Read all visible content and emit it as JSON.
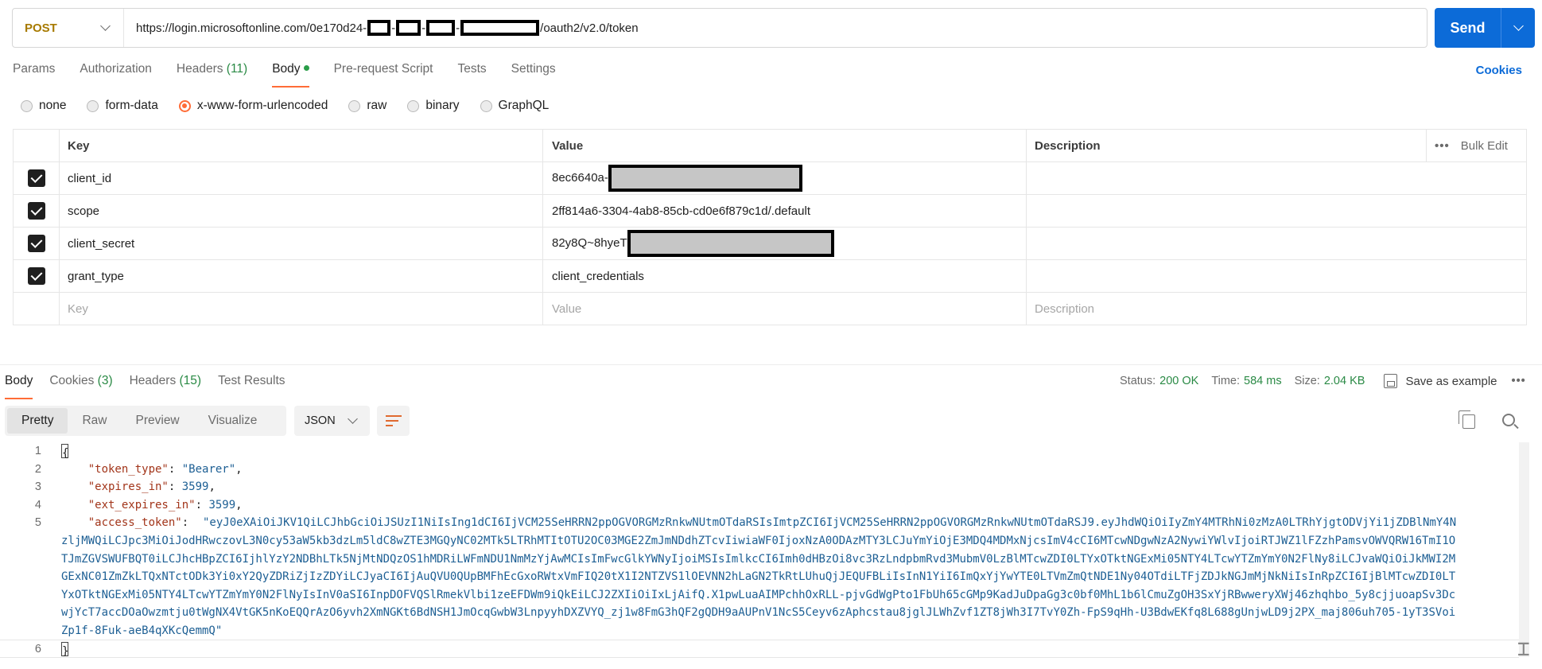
{
  "request": {
    "method": "POST",
    "url_prefix": "https://login.microsoftonline.com/0e170d24-",
    "url_suffix": "/oauth2/v2.0/token",
    "send_label": "Send"
  },
  "tabs": [
    {
      "label": "Params",
      "count": ""
    },
    {
      "label": "Authorization",
      "count": ""
    },
    {
      "label": "Headers",
      "count": "(11)"
    },
    {
      "label": "Body",
      "count": ""
    },
    {
      "label": "Pre-request Script",
      "count": ""
    },
    {
      "label": "Tests",
      "count": ""
    },
    {
      "label": "Settings",
      "count": ""
    }
  ],
  "cookies_link": "Cookies",
  "body_types": [
    "none",
    "form-data",
    "x-www-form-urlencoded",
    "raw",
    "binary",
    "GraphQL"
  ],
  "selected_body_type": "x-www-form-urlencoded",
  "params_table": {
    "headers": {
      "key": "Key",
      "value": "Value",
      "description": "Description",
      "bulk_edit": "Bulk Edit"
    },
    "rows": [
      {
        "checked": true,
        "key": "client_id",
        "value": "8ec6640a-",
        "redacted": true
      },
      {
        "checked": true,
        "key": "scope",
        "value": "2ff814a6-3304-4ab8-85cb-cd0e6f879c1d/.default",
        "redacted": false
      },
      {
        "checked": true,
        "key": "client_secret",
        "value": "82y8Q~8hyeT",
        "redacted": true
      },
      {
        "checked": true,
        "key": "grant_type",
        "value": "client_credentials",
        "redacted": false
      }
    ],
    "placeholder": {
      "key": "Key",
      "value": "Value",
      "description": "Description"
    }
  },
  "response": {
    "tabs": [
      {
        "label": "Body",
        "count": ""
      },
      {
        "label": "Cookies",
        "count": "(3)"
      },
      {
        "label": "Headers",
        "count": "(15)"
      },
      {
        "label": "Test Results",
        "count": ""
      }
    ],
    "status_label": "Status:",
    "status_value": "200 OK",
    "time_label": "Time:",
    "time_value": "584 ms",
    "size_label": "Size:",
    "size_value": "2.04 KB",
    "save_label": "Save as example",
    "views": [
      "Pretty",
      "Raw",
      "Preview",
      "Visualize"
    ],
    "format": "JSON",
    "code": {
      "line_numbers": [
        "1",
        "2",
        "3",
        "4",
        "5",
        "6"
      ],
      "open_brace": "{",
      "close_brace": "}",
      "token_type_key": "\"token_type\"",
      "token_type_val": "\"Bearer\"",
      "expires_in_key": "\"expires_in\"",
      "expires_in_val": "3599",
      "ext_expires_in_key": "\"ext_expires_in\"",
      "ext_expires_in_val": "3599",
      "access_token_key": "\"access_token\"",
      "access_token_val": "\"eyJ0eXAiOiJKV1QiLCJhbGciOiJSUzI1NiIsIng1dCI6IjVCM25SeHRRN2ppOGVORGMzRnkwNUtmOTdaRSIsImtpZCI6IjVCM25SeHRRN2ppOGVORGMzRnkwNUtmOTdaRSJ9.eyJhdWQiOiIyZmY4MTRhNi0zMzA0LTRhYjgtODVjYi1jZDBlNmY4NzljMWQiLCJpc3MiOiJodHRwczovL3N0cy53aW5kb3dzLm5ldC8wZTE3MGQyNC02MTk5LTRhMTItOTU2OC03MGE2ZmJmNDdhZTcvIiwiaWF0IjoxNzA0ODAzMTY3LCJuYmYiOjE3MDQ4MDMxNjcsImV4cCI6MTcwNDgwNzA2NywiYWlvIjoiRTJWZ1lFZzhPamsvOWVQRW16TmI1OTJmZGVSWUFBQT0iLCJhcHBpZCI6IjhlYzY2NDBhLTk5NjMtNDQzOS1hMDRiLWFmNDU1NmMzYjAwMCIsImFwcGlkYWNyIjoiMSIsImlkcCI6Imh0dHBzOi8vc3RzLndpbmRvd3MubmV0LzBlMTcwZDI0LTYxOTktNGExMi05NTY4LTcwYTZmYmY0N2FlNy8iLCJvaWQiOiJkMWI2MGExNC01ZmZkLTQxNTctODk3Yi0xY2QyZDRiZjIzZDYiLCJyaCI6IjAuQVU0QUpBMFhEcGxoRWtxVmFIQ20tX1I2NTZVS1lOEVNN2hLaGN2TkRtLUhuQjJEQUFBLiIsInN1YiI6ImQxYjYwYTE0LTVmZmQtNDE1Ny04OTdiLTFjZDJkNGJmMjNkNiIsInRpZCI6IjBlMTcwZDI0LTYxOTktNGExMi05NTY4LTcwYTZmYmY0N2FlNyIsInV0aSI6InpDOFVQSlRmekVlbi1zeEFDWm9iQkEiLCJ2ZXIiOiIxLjAifQ.X1pwLuaAIMPchhOxRLL-pjvGdWgPto1FbUh65cGMp9KadJuDpaGg3c0bf0MhL1b6lCmuZgOH3SxYjRBwweryXWj46zhqhbo_5y8cjjuoapSv3DcwjYcT7accDOaOwzmtju0tWgNX4VtGK5nKoEQQrAzO6yvh2XmNGKt6BdNSH1JmOcqGwbW3LnpyyhDXZVYQ_zj1w8FmG3hQF2gQDH9aAUPnV1NcS5Ceyv6zAphcstau8jglJLWhZvf1ZT8jWh3I7TvY0Zh-FpS9qHh-U3BdwEKfq8L688gUnjwLD9j2PX_maj806uh705-1yT3SVoiZp1f-8Fuk-aeB4qXKcQemmQ\""
    }
  }
}
